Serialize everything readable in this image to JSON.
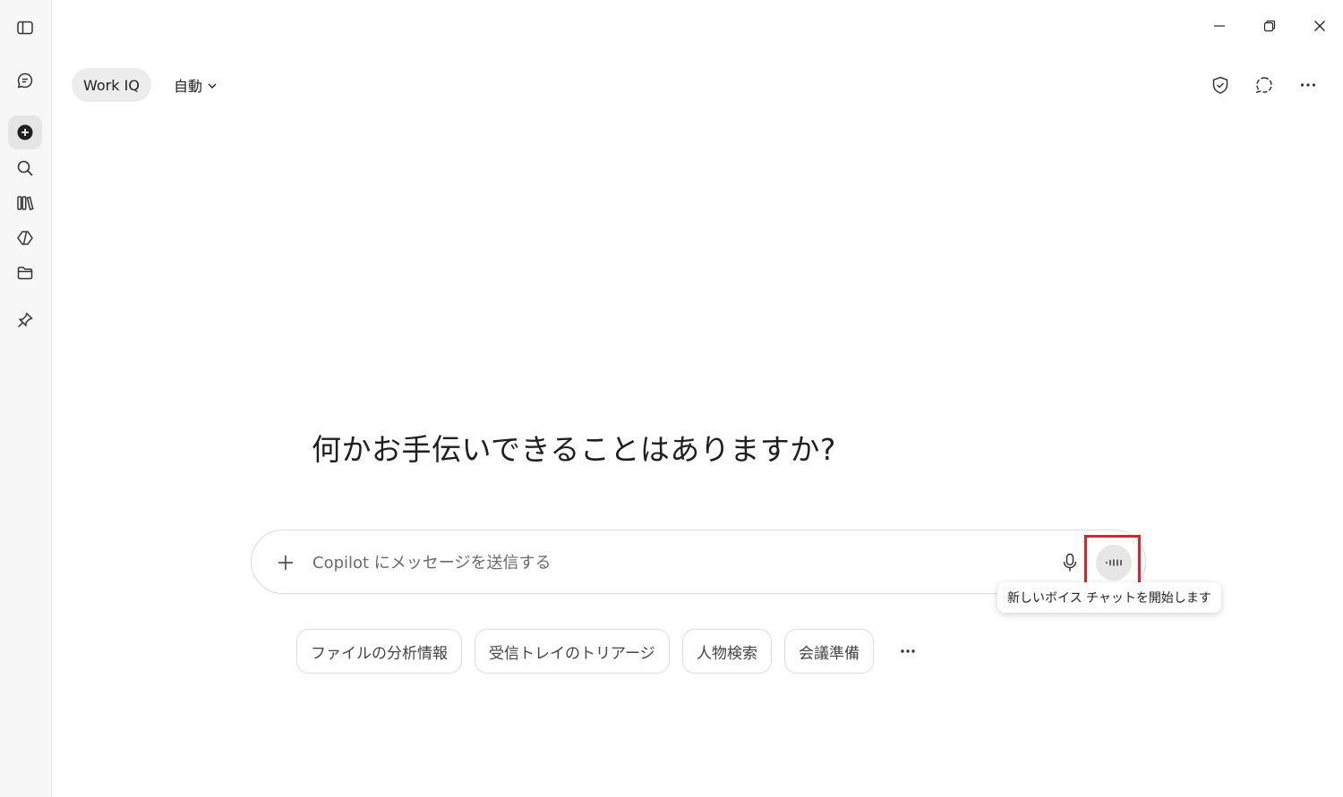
{
  "window": {
    "icons": [
      "minimize-icon",
      "restore-icon",
      "close-icon"
    ]
  },
  "sidebar": {
    "items": [
      {
        "name": "toggle-sidebar",
        "icon": "sidebar-toggle-icon"
      },
      {
        "name": "chat",
        "icon": "chat-bubble-icon"
      },
      {
        "name": "new-chat",
        "icon": "plus-circle-icon",
        "active": true
      },
      {
        "name": "search",
        "icon": "search-icon"
      },
      {
        "name": "library",
        "icon": "library-icon"
      },
      {
        "name": "agents",
        "icon": "agent-diamond-icon"
      },
      {
        "name": "files",
        "icon": "folder-icon"
      },
      {
        "name": "pinned",
        "icon": "pin-icon"
      }
    ]
  },
  "header": {
    "work_iq_label": "Work IQ",
    "mode_label": "自動",
    "icons": [
      "shield-check-icon",
      "new-conversation-icon",
      "more-icon"
    ]
  },
  "main": {
    "greeting": "何かお手伝いできることはありますか?",
    "composer": {
      "placeholder": "Copilot にメッセージを送信する",
      "value": ""
    },
    "voice_tooltip": "新しいボイス チャットを開始します",
    "suggestions": [
      "ファイルの分析情報",
      "受信トレイのトリアージ",
      "人物検索",
      "会議準備"
    ]
  },
  "colors": {
    "highlight": "#e0202a",
    "rail_bg": "#f7f7f7",
    "pill_bg": "#ececec"
  }
}
